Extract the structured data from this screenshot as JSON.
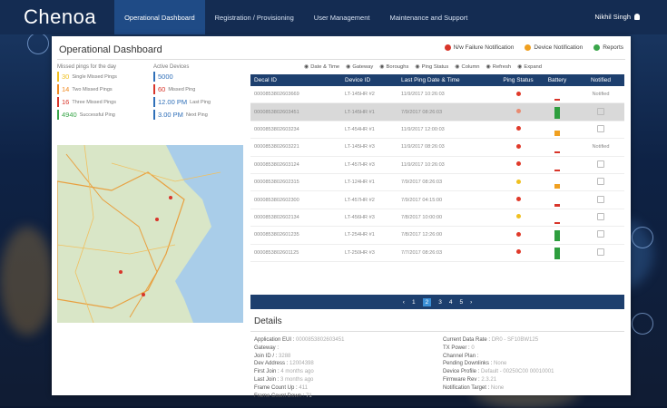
{
  "brand": {
    "logo": "Chenoa"
  },
  "nav": {
    "items": [
      {
        "label": "Operational Dashboard"
      },
      {
        "label": "Registration / Provisioning"
      },
      {
        "label": "User Management"
      },
      {
        "label": "Maintenance and Support"
      }
    ],
    "user": "Nikhil Singh"
  },
  "panel": {
    "title": "Operational Dashboard",
    "actions": [
      {
        "label": "N/w Failure Notification",
        "icon": "alert-icon",
        "color": "#d8352a"
      },
      {
        "label": "Device Notification",
        "icon": "device-icon",
        "color": "#f0a020"
      },
      {
        "label": "Reports",
        "icon": "reports-icon",
        "color": "#3aa64a"
      }
    ]
  },
  "stats": {
    "missed_header": "Missed pings for the day",
    "active_header": "Active Devices",
    "missed": [
      {
        "num": "30",
        "label": "Single Missed Pings",
        "color": "#f0c020"
      },
      {
        "num": "14",
        "label": "Two Missed Pings",
        "color": "#f08a20"
      },
      {
        "num": "16",
        "label": "Three Missed Pings",
        "color": "#d8352a"
      },
      {
        "num": "4940",
        "label": "Successful Ping",
        "color": "#3aa64a"
      }
    ],
    "active": [
      {
        "num": "5000",
        "label": "",
        "color": "#2f6fb8"
      },
      {
        "num": "60",
        "label": "Missed Ping",
        "color": "#d8352a"
      },
      {
        "num": "12.00 PM",
        "label": "Last Ping",
        "color": "#2f6fb8"
      },
      {
        "num": "3.00 PM",
        "label": "Next Ping",
        "color": "#2f6fb8"
      }
    ]
  },
  "filters": [
    "Date & Time",
    "Gateway",
    "Boroughs",
    "Ping Status",
    "Column",
    "Refresh",
    "Expand"
  ],
  "table": {
    "headers": [
      "Decal ID",
      "Device ID",
      "Last Ping Date & Time",
      "Ping Status",
      "Battery",
      "Notified"
    ],
    "rows": [
      {
        "decal": "0000853802603669",
        "device": "LT-145HR #2",
        "time": "11/9/2017 10:26:03",
        "ping": "#e03a2a",
        "battery": 0.15,
        "battcolor": "#d8352a",
        "notified": "Notified"
      },
      {
        "decal": "0000853802603451",
        "device": "LT-145HR #1",
        "time": "7/9/2017 08:26:03",
        "ping": "#e98a70",
        "battery": 0.9,
        "battcolor": "#2e9e3e",
        "notified": ""
      },
      {
        "decal": "0000853802603234",
        "device": "LT-454HR #1",
        "time": "11/9/2017 12:00:03",
        "ping": "#e03a2a",
        "battery": 0.4,
        "battcolor": "#f0a020",
        "notified": ""
      },
      {
        "decal": "0000853802603221",
        "device": "LT-145HR #3",
        "time": "11/9/2017 08:26:03",
        "ping": "#e03a2a",
        "battery": 0.15,
        "battcolor": "#d8352a",
        "notified": "Notified"
      },
      {
        "decal": "0000853802603124",
        "device": "LT-457HR #3",
        "time": "11/9/2017 10:26:03",
        "ping": "#e03a2a",
        "battery": 0.15,
        "battcolor": "#d8352a",
        "notified": ""
      },
      {
        "decal": "0000853802602315",
        "device": "LT-124HR #1",
        "time": "7/9/2017 08:26:03",
        "ping": "#f0c020",
        "battery": 0.4,
        "battcolor": "#f0a020",
        "notified": ""
      },
      {
        "decal": "0000853802602300",
        "device": "LT-457HR #2",
        "time": "7/9/2017 04:15:00",
        "ping": "#e03a2a",
        "battery": 0.15,
        "battcolor": "#d8352a",
        "notified": ""
      },
      {
        "decal": "0000853802602134",
        "device": "LT-456HR #3",
        "time": "7/8/2017 10:00:00",
        "ping": "#f0c020",
        "battery": 0.15,
        "battcolor": "#d8352a",
        "notified": ""
      },
      {
        "decal": "0000853802601235",
        "device": "LT-254HR #1",
        "time": "7/8/2017 12:26:00",
        "ping": "#e03a2a",
        "battery": 0.9,
        "battcolor": "#2e9e3e",
        "notified": ""
      },
      {
        "decal": "0000853802601125",
        "device": "LT-250HR #3",
        "time": "7/7/2017 08:26:03",
        "ping": "#e03a2a",
        "battery": 0.9,
        "battcolor": "#2e9e3e",
        "notified": ""
      }
    ]
  },
  "pager": {
    "prev": "‹",
    "pages": [
      "1",
      "2",
      "3",
      "4",
      "5"
    ],
    "current": "2",
    "next": "›"
  },
  "details": {
    "title": "Details",
    "left": [
      {
        "k": "Application EUI :",
        "v": "0000853802603451"
      },
      {
        "k": "Gateway :",
        "v": ""
      },
      {
        "k": "Join ID / :",
        "v": "3288"
      },
      {
        "k": "Dev Address :",
        "v": "12004398"
      },
      {
        "k": "First Join :",
        "v": "4 months ago"
      },
      {
        "k": "Last Join :",
        "v": "3 months ago"
      },
      {
        "k": "Frame Count Up :",
        "v": "411"
      },
      {
        "k": "Frame Count Down :",
        "v": "71"
      }
    ],
    "right": [
      {
        "k": "Current Data Rate :",
        "v": "DR0 - SF10BW125"
      },
      {
        "k": "TX Power :",
        "v": "0"
      },
      {
        "k": "Channel Plan :",
        "v": ""
      },
      {
        "k": "Pending Downlinks :",
        "v": "None"
      },
      {
        "k": "Device Profile :",
        "v": "Default - 00250C00 00010001"
      },
      {
        "k": "Firmware Rev :",
        "v": "2.3.21"
      },
      {
        "k": "Notification Target :",
        "v": "None"
      }
    ]
  }
}
